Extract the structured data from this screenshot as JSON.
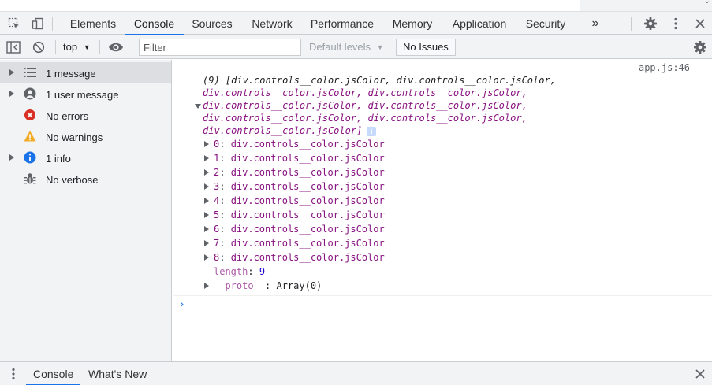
{
  "tabs": [
    "Elements",
    "Console",
    "Sources",
    "Network",
    "Performance",
    "Memory",
    "Application",
    "Security"
  ],
  "more_tabs": "»",
  "toolbar": {
    "context": "top",
    "filter_placeholder": "Filter",
    "levels": "Default levels",
    "issues": "No Issues"
  },
  "sidebar": {
    "items": [
      {
        "label": "1 message",
        "icon": "list-icon",
        "expandable": true
      },
      {
        "label": "1 user message",
        "icon": "user-icon",
        "expandable": true
      },
      {
        "label": "No errors",
        "icon": "error-icon",
        "expandable": false
      },
      {
        "label": "No warnings",
        "icon": "warning-icon",
        "expandable": false
      },
      {
        "label": "1 info",
        "icon": "info-icon",
        "expandable": true
      },
      {
        "label": "No verbose",
        "icon": "bug-icon",
        "expandable": false
      }
    ]
  },
  "console": {
    "source": "app.js:46",
    "summary_lines": [
      "(9) [div.controls__color.jsColor, div.controls__color.jsColor,",
      "div.controls__color.jsColor, div.controls__color.jsColor,",
      "div.controls__color.jsColor, div.controls__color.jsColor,",
      "div.controls__color.jsColor, div.controls__color.jsColor,",
      "div.controls__color.jsColor]"
    ],
    "entries": [
      {
        "key": "0",
        "value": "div.controls__color.jsColor"
      },
      {
        "key": "1",
        "value": "div.controls__color.jsColor"
      },
      {
        "key": "2",
        "value": "div.controls__color.jsColor"
      },
      {
        "key": "3",
        "value": "div.controls__color.jsColor"
      },
      {
        "key": "4",
        "value": "div.controls__color.jsColor"
      },
      {
        "key": "5",
        "value": "div.controls__color.jsColor"
      },
      {
        "key": "6",
        "value": "div.controls__color.jsColor"
      },
      {
        "key": "7",
        "value": "div.controls__color.jsColor"
      },
      {
        "key": "8",
        "value": "div.controls__color.jsColor"
      }
    ],
    "length_key": "length",
    "length_value": "9",
    "proto_key": "__proto__",
    "proto_value": "Array(0)",
    "info_badge": "i"
  },
  "drawer": {
    "tabs": [
      "Console",
      "What's New"
    ]
  },
  "colors": {
    "accent": "#1a73e8",
    "error": "#d93025",
    "warning": "#f2ab26",
    "info": "#1a73e8"
  }
}
